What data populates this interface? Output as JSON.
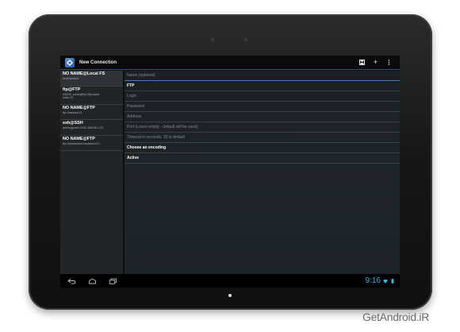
{
  "app": {
    "title": "New Connection"
  },
  "actions": {
    "save": "save-icon",
    "add": "+",
    "overflow": "overflow-icon"
  },
  "connections": [
    {
      "title": "NO NAME@Local FS",
      "subtitle": "/mnt/sdcard"
    },
    {
      "title": "ftp@FTP",
      "subtitle": "u5493_sshio@ftp://ftp.subd",
      "subtitle2": "main:21"
    },
    {
      "title": "NO NAME@FTP",
      "subtitle": "ftp://asdasd:21"
    },
    {
      "title": "ssh@SSH",
      "subtitle": "andreyjpush://192.168.56.1:22"
    },
    {
      "title": "NO NAME@FTP",
      "subtitle": "ftp://asdasdasd:asdasd:n21"
    }
  ],
  "form": {
    "name_placeholder": "Name (optional)",
    "protocol_value": "FTP",
    "login_placeholder": "Login",
    "password_placeholder": "Password",
    "address_placeholder": "Address",
    "port_placeholder": "Port (Leave empty - default will be used)",
    "timeout_placeholder": "Timeout in seconds. 20 is default",
    "encoding_label": "Choose an encoding",
    "mode_value": "Active"
  },
  "status_bar": {
    "time": "9:16"
  },
  "watermark": "GetAndroid.iR",
  "colors": {
    "accent": "#33b5e5",
    "underline": "#3d7fc0",
    "background": "#111417"
  }
}
